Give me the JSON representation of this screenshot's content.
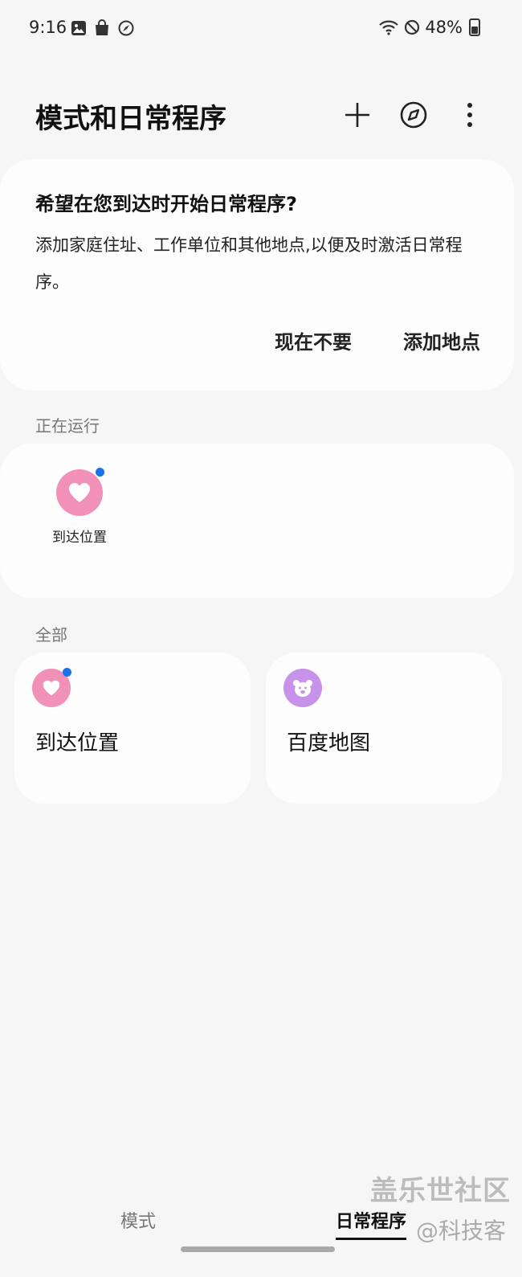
{
  "status_bar": {
    "time": "9:16",
    "battery": "48%",
    "left_icons": [
      "image-icon",
      "shopping-bag-icon",
      "compass-sync-icon"
    ],
    "right_icons": [
      "wifi-icon",
      "do-not-disturb-icon",
      "battery-icon"
    ]
  },
  "header": {
    "title": "模式和日常程序",
    "actions": [
      "add-icon",
      "discover-icon",
      "more-options-icon"
    ]
  },
  "prompt_card": {
    "title": "希望在您到达时开始日常程序?",
    "body": "添加家庭住址、工作单位和其他地点,以便及时激活日常程序。",
    "not_now_label": "现在不要",
    "add_location_label": "添加地点"
  },
  "running": {
    "section_label": "正在运行",
    "items": [
      {
        "label": "到达位置",
        "icon": "heart-icon",
        "color": "#f291b8",
        "active": true
      }
    ]
  },
  "all": {
    "section_label": "全部",
    "items": [
      {
        "label": "到达位置",
        "icon": "heart-icon",
        "color": "#f291b8",
        "active": true
      },
      {
        "label": "百度地图",
        "icon": "bear-icon",
        "color": "#c792ea",
        "active": false
      }
    ]
  },
  "bottom_nav": {
    "tabs": [
      {
        "label": "模式",
        "selected": false
      },
      {
        "label": "日常程序",
        "selected": true
      }
    ]
  },
  "watermark": {
    "main": "盖乐世社区",
    "sub": "@科技客"
  },
  "colors": {
    "background": "#f6f6f6",
    "card": "#fdfdfd",
    "accent_dot": "#1a73e8",
    "pink": "#f291b8",
    "purple": "#c792ea"
  }
}
